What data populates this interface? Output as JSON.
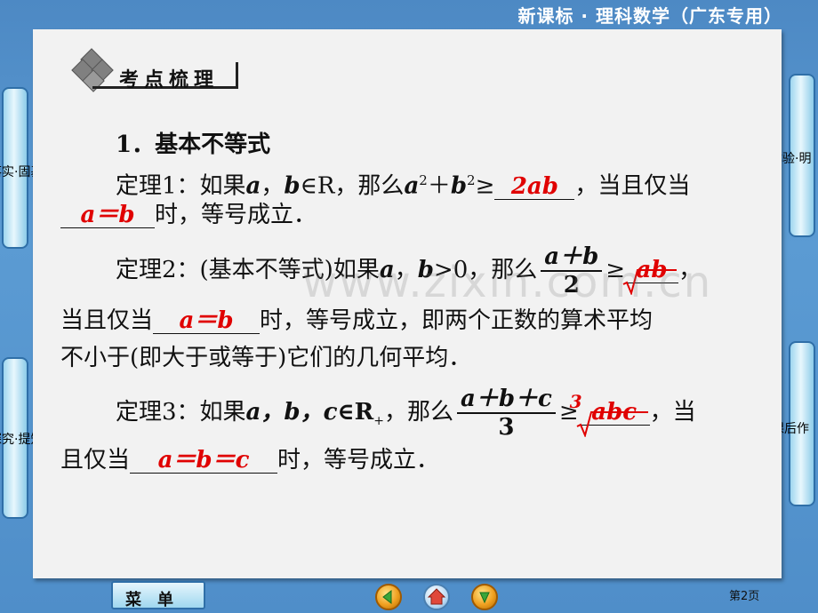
{
  "header": {
    "title": "新课标 · 理科数学（广东专用）"
  },
  "sidebar_left": [
    {
      "label": "落实·固基础"
    },
    {
      "label": "探究·提知能"
    }
  ],
  "sidebar_right": [
    {
      "label": "高考体验·明"
    },
    {
      "label": "课后作"
    }
  ],
  "section_title": "考点梳理",
  "content": {
    "heading": "1．基本不等式",
    "theorem1": {
      "prefix": "定理1：如果",
      "var_a": "a",
      "comma": "，",
      "var_b": "b",
      "in_R": "∈R，那么",
      "a2": "a",
      "plus": "＋",
      "b2": "b",
      "exp": "2",
      "geq": "≥",
      "answer1": "2ab",
      "suffix1": "，当且仅当",
      "answer2": "a＝b",
      "suffix2": "时，等号成立．"
    },
    "theorem2": {
      "prefix": "定理2：(基本不等式)如果",
      "var_a": "a",
      "comma": "，",
      "var_b": "b",
      "cond": ">0，那么",
      "frac_num": "a＋b",
      "frac_den": "2",
      "geq": "≥",
      "answer1": "ab",
      "suffix1": "，",
      "line2_prefix": "当且仅当",
      "answer2": "a＝b",
      "line2_suffix": "时，等号成立，即两个正数的算术平均",
      "line3": "不小于(即大于或等于)它们的几何平均．"
    },
    "theorem3": {
      "prefix": "定理3：如果",
      "vars": "a，b，c",
      "in_R": "∈R",
      "plus_sub": "+",
      "then": "，那么",
      "frac_num": "a＋b＋c",
      "frac_den": "3",
      "geq": "≥",
      "root_index": "3",
      "answer1": "abc",
      "suffix1": "，当",
      "line2_prefix": "且仅当",
      "answer2": "a＝b＝c",
      "line2_suffix": "时，等号成立．"
    }
  },
  "watermark": "www.zixin.com.cn",
  "footer": {
    "menu_label": "菜　单",
    "page_number": "第2页"
  },
  "colors": {
    "background": "#5b9bd3",
    "answer": "#e00000",
    "panel": "#f2f2f2"
  }
}
